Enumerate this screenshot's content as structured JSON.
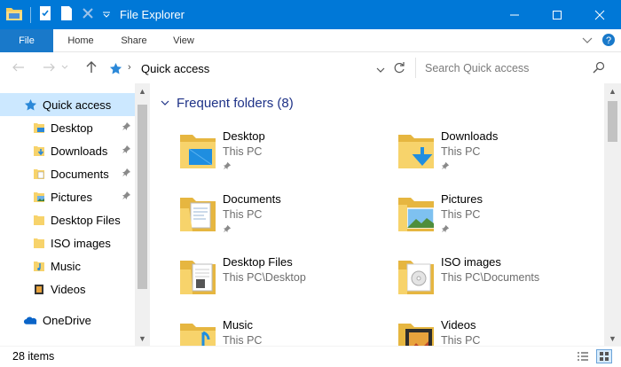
{
  "window": {
    "title": "File Explorer",
    "controls": {
      "minimize": "—",
      "maximize": "☐",
      "close": "✕"
    }
  },
  "ribbon": {
    "tabs": [
      {
        "label": "File"
      },
      {
        "label": "Home"
      },
      {
        "label": "Share"
      },
      {
        "label": "View"
      }
    ]
  },
  "address": {
    "path": "Quick access",
    "search_placeholder": "Search Quick access"
  },
  "nav": {
    "items": [
      {
        "label": "Quick access",
        "icon": "star-icon",
        "pinned": false,
        "selected": true
      },
      {
        "label": "Desktop",
        "icon": "desktop-folder-icon",
        "pinned": true
      },
      {
        "label": "Downloads",
        "icon": "downloads-folder-icon",
        "pinned": true
      },
      {
        "label": "Documents",
        "icon": "documents-folder-icon",
        "pinned": true
      },
      {
        "label": "Pictures",
        "icon": "pictures-folder-icon",
        "pinned": true
      },
      {
        "label": "Desktop Files",
        "icon": "folder-icon",
        "pinned": false
      },
      {
        "label": "ISO images",
        "icon": "folder-icon",
        "pinned": false
      },
      {
        "label": "Music",
        "icon": "music-folder-icon",
        "pinned": false
      },
      {
        "label": "Videos",
        "icon": "videos-folder-icon",
        "pinned": false
      },
      {
        "label": "OneDrive",
        "icon": "onedrive-icon",
        "pinned": false
      }
    ]
  },
  "content": {
    "group_header": "Frequent folders (8)",
    "folders": [
      {
        "name": "Desktop",
        "location": "This PC",
        "pinned": true,
        "icon": "desktop-folder-icon"
      },
      {
        "name": "Downloads",
        "location": "This PC",
        "pinned": true,
        "icon": "downloads-folder-icon"
      },
      {
        "name": "Documents",
        "location": "This PC",
        "pinned": true,
        "icon": "documents-folder-icon"
      },
      {
        "name": "Pictures",
        "location": "This PC",
        "pinned": true,
        "icon": "pictures-folder-icon"
      },
      {
        "name": "Desktop Files",
        "location": "This PC\\Desktop",
        "pinned": false,
        "icon": "folder-icon"
      },
      {
        "name": "ISO images",
        "location": "This PC\\Documents",
        "pinned": false,
        "icon": "folder-icon"
      },
      {
        "name": "Music",
        "location": "This PC",
        "pinned": false,
        "icon": "music-folder-icon"
      },
      {
        "name": "Videos",
        "location": "This PC",
        "pinned": false,
        "icon": "videos-folder-icon"
      }
    ]
  },
  "status": {
    "item_count": "28 items"
  },
  "colors": {
    "titlebar": "#0078d7",
    "file_tab": "#1979ca",
    "selected_nav": "#cce8ff",
    "group_header": "#1e3287",
    "folder_yellow": "#f7d36b"
  }
}
